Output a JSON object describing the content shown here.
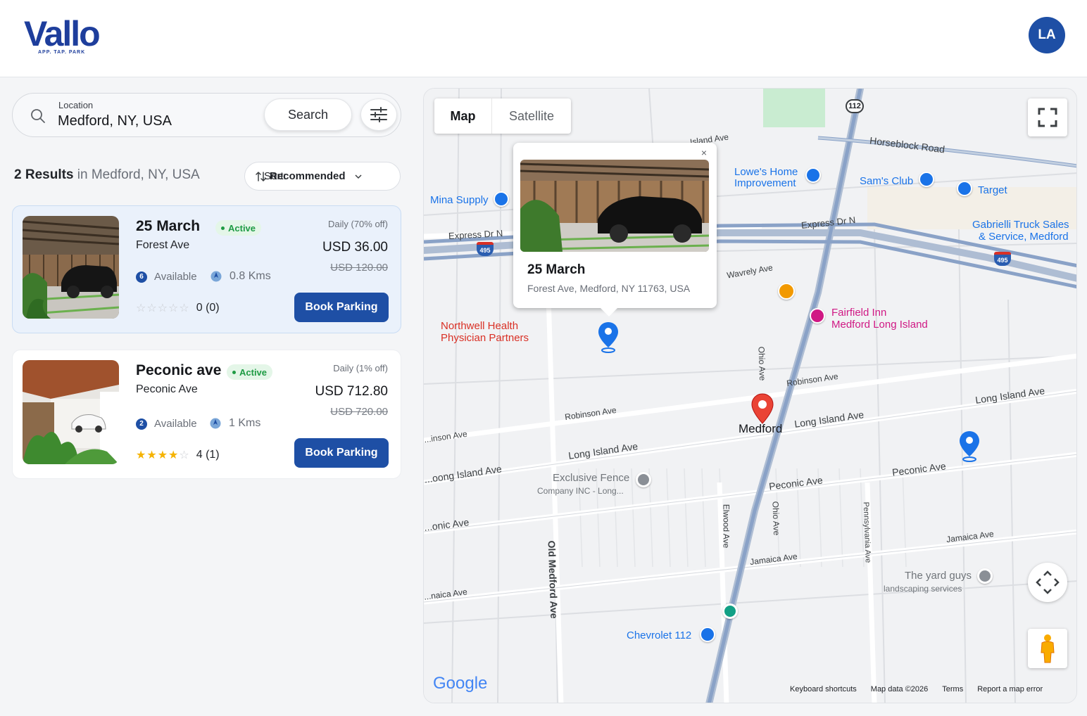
{
  "brand": {
    "name": "Vallo",
    "tagline": "APP. TAP. PARK",
    "color": "#1e3e9c"
  },
  "user": {
    "initials": "LA"
  },
  "search": {
    "label": "Location",
    "value": "Medford, NY, USA",
    "button": "Search"
  },
  "results": {
    "count": "2",
    "count_word": "Results",
    "in_word": "in",
    "location": "Medford, NY, USA"
  },
  "sort": {
    "label": "Sort:",
    "value": "Recommended"
  },
  "listings": [
    {
      "title": "25 March",
      "status": "Active",
      "street": "Forest Ave",
      "daily": "Daily (70% off)",
      "price": "USD 36.00",
      "old_price": "USD 120.00",
      "available_count": "6",
      "available_label": "Available",
      "distance": "0.8 Kms",
      "rating": 0,
      "rating_text": "0 (0)",
      "button": "Book Parking"
    },
    {
      "title": "Peconic ave",
      "status": "Active",
      "street": "Peconic Ave",
      "daily": "Daily (1% off)",
      "price": "USD 712.80",
      "old_price": "USD 720.00",
      "available_count": "2",
      "available_label": "Available",
      "distance": "1 Kms",
      "rating": 4,
      "rating_text": "4 (1)",
      "button": "Book Parking"
    }
  ],
  "map": {
    "type_options": [
      "Map",
      "Satellite"
    ],
    "selected_type": "Map",
    "info_window": {
      "title": "25 March",
      "address": "Forest Ave, Medford, NY 11763, USA",
      "close": "×"
    },
    "town": "Medford",
    "pois": {
      "mina_supply": "Mina Supply",
      "lowes_1": "Lowe's Home",
      "lowes_2": "Improvement",
      "sams_club": "Sam's Club",
      "target": "Target",
      "gabrielli_1": "Gabrielli Truck Sales",
      "gabrielli_2": "& Service, Medford",
      "northwell_1": "Northwell Health",
      "northwell_2": "Physician Partners",
      "fairfield_1": "Fairfield Inn",
      "fairfield_2": "Medford Long Island",
      "exclusive_1": "Exclusive Fence",
      "exclusive_2": "Company INC - Long...",
      "yard_1": "The yard guys",
      "yard_2": "landscaping services",
      "chevrolet": "Chevrolet 112"
    },
    "roads": {
      "horseblock": "Horseblock Road",
      "express_n1": "Express Dr N",
      "express_n2": "Express Dr N",
      "island_ave": "...Island Ave",
      "wavrely": "Wavrely Ave",
      "robinson1": "Robinson Ave",
      "robinson2": "Robinson Ave",
      "robinson3": "...inson Ave",
      "long_island1": "Long Island Ave",
      "long_island2": "Long Island Ave",
      "long_island3": "Long Island Ave",
      "long_island4": "...oong Island Ave",
      "peconic1": "Peconic Ave",
      "peconic2": "Peconic Ave",
      "peconic3": "...onic Ave",
      "jamaica1": "Jamaica Ave",
      "jamaica2": "Jamaica Ave",
      "jamaica3": "...naica Ave",
      "ohio1": "Ohio Ave",
      "ohio2": "Ohio Ave",
      "old_medford": "Old Medford Ave",
      "elwood": "Elwood Ave",
      "pennsylvania": "Pennsylvania Ave",
      "route112": "112",
      "i495a": "495",
      "i495b": "495"
    },
    "google": "Google",
    "footer": [
      "Keyboard shortcuts",
      "Map data ©2026",
      "Terms",
      "Report a map error"
    ]
  },
  "colors": {
    "primary": "#1e4fa5",
    "active_green": "#1e9b44",
    "map_pin_blue": "#1a73e8",
    "map_pin_red": "#ea4335"
  }
}
